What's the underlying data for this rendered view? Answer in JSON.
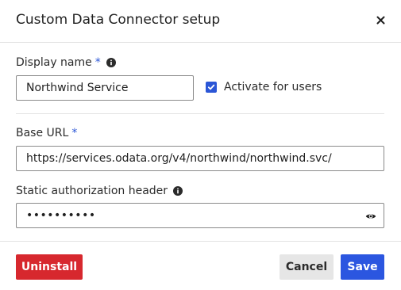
{
  "dialog": {
    "title": "Custom Data Connector setup",
    "close_icon": "close-icon"
  },
  "form": {
    "display_name": {
      "label": "Display name",
      "required_marker": "*",
      "info_icon": "info-icon",
      "value": "Northwind Service"
    },
    "activate": {
      "label": "Activate for users",
      "checked": true
    },
    "base_url": {
      "label": "Base URL",
      "required_marker": "*",
      "value": "https://services.odata.org/v4/northwind/northwind.svc/"
    },
    "auth_header": {
      "label": "Static authorization header",
      "info_icon": "info-icon",
      "masked_value": "••••••••••",
      "reveal_icon": "eye-icon"
    }
  },
  "footer": {
    "uninstall_label": "Uninstall",
    "cancel_label": "Cancel",
    "save_label": "Save"
  },
  "colors": {
    "accent": "#2b56d6",
    "danger": "#d7282e",
    "primary_button": "#2b56e0",
    "secondary_button": "#e6e6e6"
  }
}
